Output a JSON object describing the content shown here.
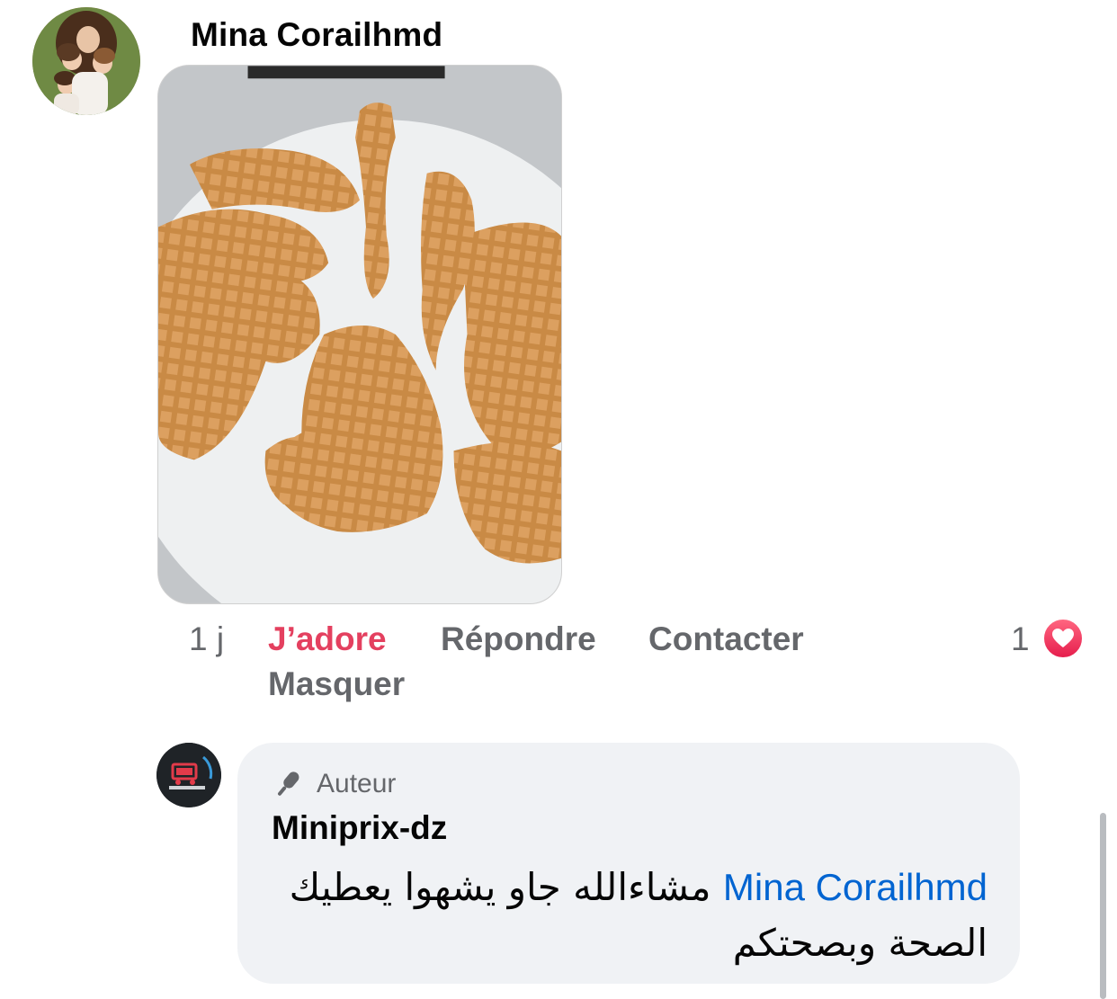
{
  "comment": {
    "author": "Mina Corailhmd",
    "avatar_icon": "profile-photo",
    "photo_description_icon": "waffles-photo",
    "time": "1 j",
    "actions": {
      "like": "J’adore",
      "reply": "Répondre",
      "contact": "Contacter",
      "hide": "Masquer"
    },
    "reaction_count": "1",
    "reaction_icon": "heart-icon"
  },
  "reply": {
    "badge_icon": "microphone-icon",
    "badge": "Auteur",
    "author": "Miniprix-dz",
    "mention": "Mina Corailhmd",
    "text": "مشاءالله جاو يشهوا يعطيك الصحة وبصحتكم"
  },
  "colors": {
    "like": "#e4405f",
    "mention": "#0064d1",
    "bubble": "#f0f2f5",
    "secondary_text": "#65676b"
  }
}
